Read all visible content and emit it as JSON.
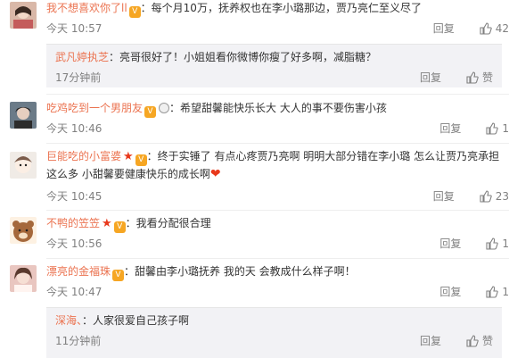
{
  "reply_label": "回复",
  "zan_label": "赞",
  "comments": [
    {
      "user": "我不想喜欢你了ll",
      "text": "：每个月10万，抚养权也在李小璐那边，贾乃亮仁至义尽了",
      "time": "今天 10:57",
      "likes": "42"
    },
    {
      "user": "武凡婷执芝",
      "text": "：亮哥很好了！小姐姐看你微博你瘦了好多啊，减脂糖？",
      "time": "17分钟前",
      "likes": "赞"
    },
    {
      "user": "吃鸡吃到一个男朋友",
      "text": "：希望甜馨能快乐长大 大人的事不要伤害小孩",
      "time": "今天 10:46",
      "likes": "1"
    },
    {
      "user": "巨能吃的小富婆",
      "text": "：终于实锤了 有点心疼贾乃亮啊 明明大部分错在李小璐 怎么让贾乃亮承担",
      "text2": "这么多 小甜馨要健康快乐的成长啊",
      "time": "今天 10:45",
      "likes": "23"
    },
    {
      "user": "不鸭的笠笠",
      "text": "：我看分配很合理",
      "time": "今天 10:56",
      "likes": "1"
    },
    {
      "user": "漂亮的金福珠",
      "text": "：甜馨由李小璐抚养 我的天 会教成什么样子啊！",
      "time": "今天 10:47",
      "likes": "1"
    },
    {
      "user": "深海、",
      "text": "：人家很爱自己孩子啊",
      "time": "11分钟前",
      "likes": "赞"
    }
  ]
}
